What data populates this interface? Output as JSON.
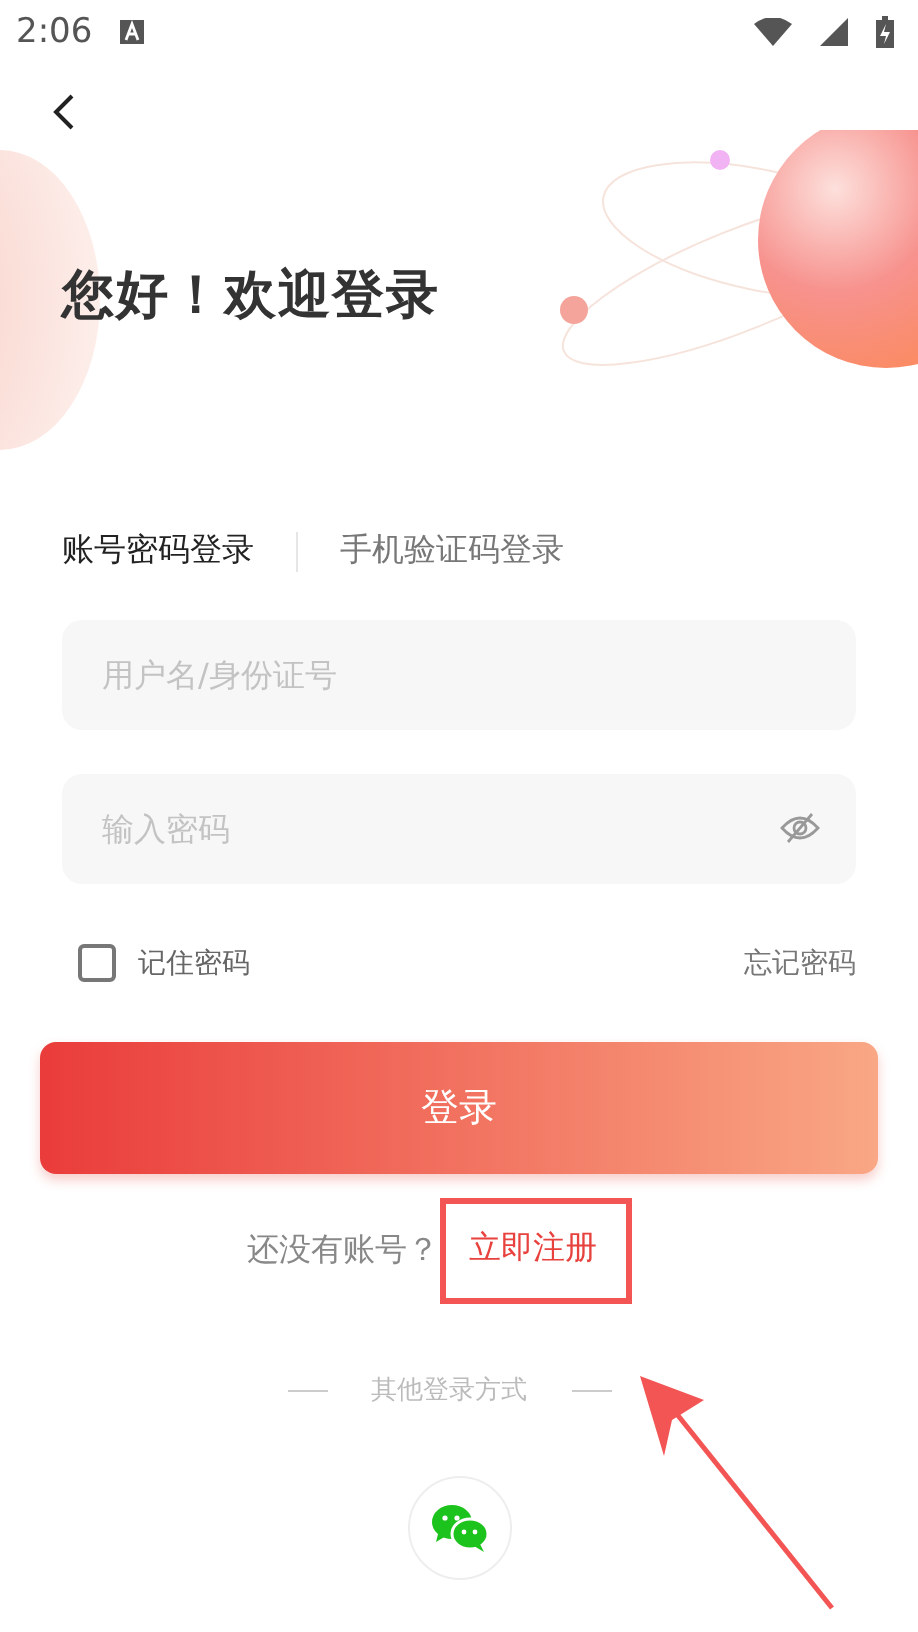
{
  "status_bar": {
    "time": "2:06"
  },
  "title": "您好！欢迎登录",
  "tabs": [
    {
      "label": "账号密码登录",
      "selected": true
    },
    {
      "label": "手机验证码登录",
      "selected": false
    }
  ],
  "fields": [
    {
      "placeholder": "用户名/身份证号",
      "kind": "text"
    },
    {
      "placeholder": "输入密码",
      "kind": "password"
    }
  ],
  "remember": {
    "label": "记住密码",
    "checked": false
  },
  "forgot": "忘记密码",
  "login_button": "登录",
  "register": {
    "prompt": "还没有账号？",
    "link": "立即注册"
  },
  "other_login": "其他登录方式"
}
